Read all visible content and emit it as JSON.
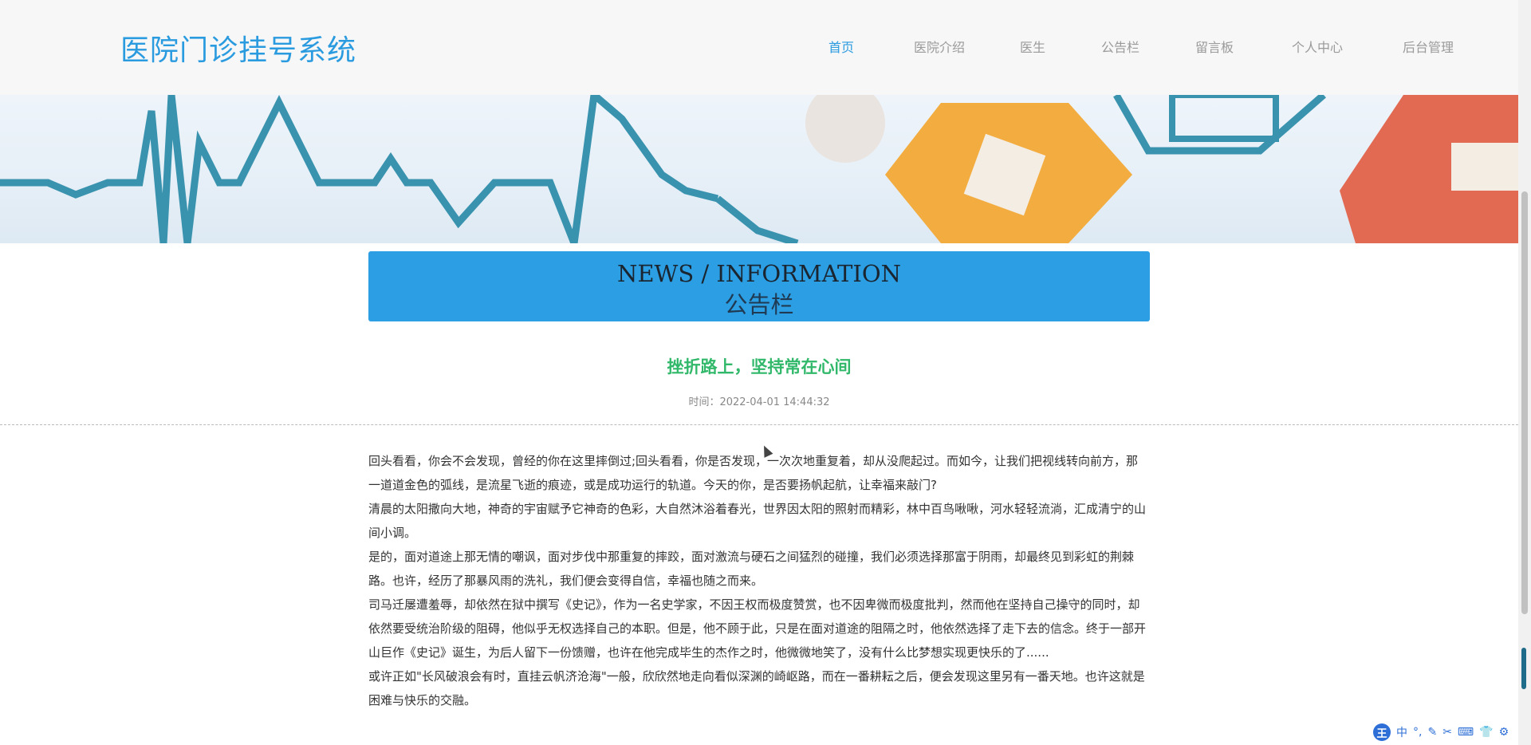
{
  "header": {
    "logo": "医院门诊挂号系统",
    "nav": [
      {
        "label": "首页",
        "active": true
      },
      {
        "label": "医院介绍",
        "active": false
      },
      {
        "label": "医生",
        "active": false
      },
      {
        "label": "公告栏",
        "active": false
      },
      {
        "label": "留言板",
        "active": false
      },
      {
        "label": "个人中心",
        "active": false
      },
      {
        "label": "后台管理",
        "active": false
      }
    ]
  },
  "section": {
    "title_en": "NEWS / INFORMATION",
    "title_cn": "公告栏"
  },
  "article": {
    "title": "挫折路上，坚持常在心间",
    "time_label": "时间：2022-04-01 14:44:32",
    "paragraphs": [
      "回头看看，你会不会发现，曾经的你在这里摔倒过;回头看看，你是否发现，一次次地重复着，却从没爬起过。而如今，让我们把视线转向前方，那一道道金色的弧线，是流星飞逝的痕迹，或是成功运行的轨道。今天的你，是否要扬帆起航，让幸福来敲门?",
      "清晨的太阳撒向大地，神奇的宇宙赋予它神奇的色彩，大自然沐浴着春光，世界因太阳的照射而精彩，林中百鸟啾啾，河水轻轻流淌，汇成清宁的山间小调。",
      "是的，面对道途上那无情的嘲讽，面对步伐中那重复的摔跤，面对激流与硬石之间猛烈的碰撞，我们必须选择那富于阴雨，却最终见到彩虹的荆棘路。也许，经历了那暴风雨的洗礼，我们便会变得自信，幸福也随之而来。",
      "司马迁屡遭羞辱，却依然在狱中撰写《史记》，作为一名史学家，不因王权而极度赞赏，也不因卑微而极度批判，然而他在坚持自己操守的同时，却依然要受统治阶级的阻碍，他似乎无权选择自己的本职。但是，他不顾于此，只是在面对道途的阻隔之时，他依然选择了走下去的信念。终于一部开山巨作《史记》诞生，为后人留下一份馈赠，也许在他完成毕生的杰作之时，他微微地笑了，没有什么比梦想实现更快乐的了......",
      "或许正如\"长风破浪会有时，直挂云帆济沧海\"一般，欣欣然地走向看似深渊的崎岖路，而在一番耕耘之后，便会发现这里另有一番天地。也许这就是困难与快乐的交融。"
    ]
  },
  "ime": {
    "badge": "王",
    "mode": "中",
    "icons": [
      "punctuation-icon",
      "pen-icon",
      "scissors-icon",
      "keyboard-icon",
      "shirt-icon",
      "gear-icon"
    ]
  },
  "colors": {
    "brand": "#2b9be0",
    "title_bar": "#2c9ee4",
    "article_title": "#31b86a",
    "nav_inactive": "#9a9a9a"
  }
}
